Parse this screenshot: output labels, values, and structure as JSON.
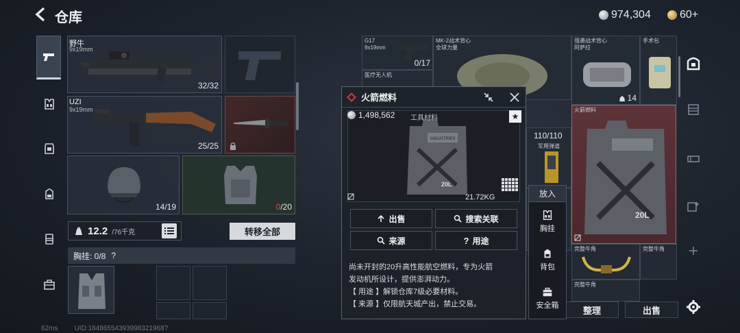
{
  "header": {
    "title": "仓库",
    "silver_amount": "974,304",
    "gold_amount": "60+"
  },
  "sidebar": {
    "items": [
      {
        "name": "pistol",
        "active": true
      },
      {
        "name": "chest-rig"
      },
      {
        "name": "armor"
      },
      {
        "name": "backpack"
      },
      {
        "name": "container"
      },
      {
        "name": "case"
      }
    ]
  },
  "inventory": {
    "weapons": [
      {
        "name": "野牛",
        "caliber": "9x19mm",
        "durability": "32/32"
      },
      {
        "name": "UZI",
        "caliber": "9x19mm",
        "durability": "25/25"
      }
    ],
    "helmet_durability": "14/19",
    "armor_durability_cur": "0",
    "armor_durability_max": "/20",
    "weight_current": "12.2",
    "weight_max": "/76千克",
    "transfer_all": "转移全部",
    "rig_label": "胸挂: 0/8",
    "rig_help": "?",
    "status_ping": "62ms",
    "status_uid": "UID:18486554393998321968?"
  },
  "stash": {
    "cells": [
      {
        "name": "G17",
        "sub": "9x19mm",
        "count": "0/17"
      },
      {
        "name": "MK-2战术背心",
        "sub": "全球力量"
      },
      {
        "name": "强袭战术背心",
        "sub": "阿萨拉"
      },
      {
        "name": "手术包"
      },
      {
        "name": "医疗无人机"
      },
      {
        "name": "火箭燃料"
      },
      {
        "name": "军用弹道"
      },
      {
        "name": "完整牛角"
      },
      {
        "name": "完整牛角"
      },
      {
        "name": "完整牛角"
      }
    ],
    "bag_count": "14",
    "ammo_count": "110/110",
    "sort_label": "整理",
    "sell_label": "出售"
  },
  "popup": {
    "title": "火箭燃料",
    "price": "1,498,562",
    "type": "工具材料",
    "weight": "21.72KG",
    "can_text_1": "INDUSTRIES",
    "can_text_2": "20L",
    "buttons": {
      "sell": "出售",
      "search": "搜索关联",
      "source": "来源",
      "usage": "用途"
    },
    "desc": [
      "尚未开封的20升高性能航空燃料，专为火箭",
      "发动机所设计，提供澎湃动力。",
      "【 用途 】解锁仓库7级必要材料。",
      "【 来源 】仅限航天城产出，禁止交易。"
    ]
  },
  "put_menu": {
    "title": "放入",
    "items": [
      "胸挂",
      "背包",
      "安全箱"
    ]
  },
  "colors": {
    "accent_red": "#c83a3a",
    "fuel_highlight": "#6a3a3e"
  }
}
